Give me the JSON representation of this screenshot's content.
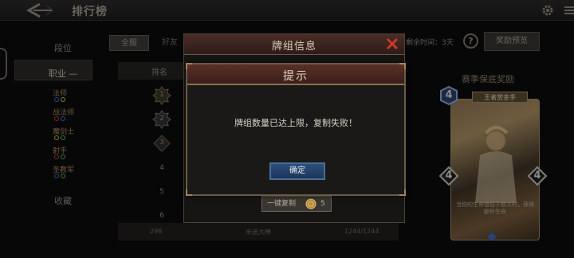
{
  "topbar": {
    "title": "排行榜"
  },
  "sidebar": {
    "items": [
      {
        "label": "段位"
      },
      {
        "label": "职业 —"
      },
      {
        "label": "收藏"
      }
    ],
    "classes": [
      {
        "label": "法师"
      },
      {
        "label": "战法师"
      },
      {
        "label": "魔剑士"
      },
      {
        "label": "射手"
      },
      {
        "label": "圣教军"
      }
    ]
  },
  "filters": {
    "all_label": "全服",
    "friends_label": "好友"
  },
  "season": {
    "remaining_text": "剩余时间：3天",
    "help_label": "?",
    "reward_preview_label": "奖励预览"
  },
  "table": {
    "rank_header": "排名",
    "ranks": [
      "1",
      "2",
      "3",
      "4",
      "5",
      "6"
    ],
    "footer": {
      "rank": "298",
      "name": "米迷大棒",
      "score": "1244/1244"
    }
  },
  "reward_panel": {
    "title": "赛季保底奖励",
    "card_name": "王者赏金手",
    "card_cost_top": "4",
    "card_cost_left": "4",
    "card_cost_right": "4",
    "card_desc": "当你的生命值低于敌方时，获得额外生命"
  },
  "deck_dialog": {
    "title": "牌组信息",
    "copy_label": "一键复制",
    "copy_cost": "5"
  },
  "tip_dialog": {
    "title": "提示",
    "message": "牌组数量已达上限，复制失败！",
    "confirm_label": "确定"
  },
  "colors": {
    "accent_red": "#c8392b",
    "confirm_blue": "#2d4f7c",
    "gold_frame": "#a08560"
  }
}
